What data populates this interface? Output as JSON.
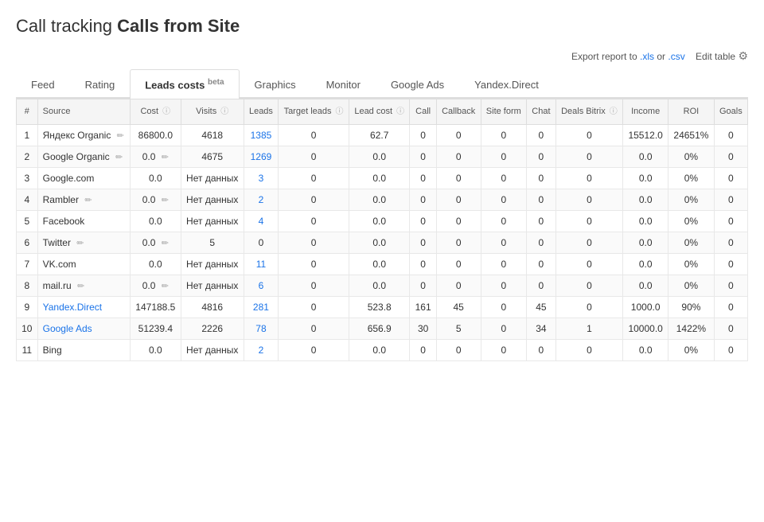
{
  "title": {
    "prefix": "Call tracking",
    "bold": "Calls from Site"
  },
  "export": {
    "text": "Export report to",
    "xls": ".xls",
    "or": "or",
    "csv": ".csv",
    "edit_table": "Edit table"
  },
  "tabs": [
    {
      "id": "feed",
      "label": "Feed",
      "active": false
    },
    {
      "id": "rating",
      "label": "Rating",
      "active": false
    },
    {
      "id": "leads_costs",
      "label": "Leads costs",
      "beta": "beta",
      "active": true
    },
    {
      "id": "graphics",
      "label": "Graphics",
      "active": false
    },
    {
      "id": "monitor",
      "label": "Monitor",
      "active": false
    },
    {
      "id": "google_ads",
      "label": "Google Ads",
      "active": false
    },
    {
      "id": "yandex_direct",
      "label": "Yandex.Direct",
      "active": false
    }
  ],
  "columns": [
    {
      "id": "num",
      "label": "#"
    },
    {
      "id": "source",
      "label": "Source"
    },
    {
      "id": "cost",
      "label": "Cost",
      "info": true
    },
    {
      "id": "visits",
      "label": "Visits",
      "info": true
    },
    {
      "id": "leads",
      "label": "Leads"
    },
    {
      "id": "target_leads",
      "label": "Target leads",
      "info": true
    },
    {
      "id": "lead_cost",
      "label": "Lead cost",
      "info": true
    },
    {
      "id": "call",
      "label": "Call"
    },
    {
      "id": "callback",
      "label": "Callback"
    },
    {
      "id": "site_form",
      "label": "Site form"
    },
    {
      "id": "chat",
      "label": "Chat"
    },
    {
      "id": "deals_bitrix",
      "label": "Deals Bitrix",
      "info": true
    },
    {
      "id": "income",
      "label": "Income"
    },
    {
      "id": "roi",
      "label": "ROI"
    },
    {
      "id": "goals",
      "label": "Goals"
    }
  ],
  "rows": [
    {
      "num": 1,
      "source": "Яндекс Organic",
      "editable": true,
      "cost": "86800.0",
      "visits": "4618",
      "leads_link": "1385",
      "leads_link_href": true,
      "target_leads": "0",
      "lead_cost": "62.7",
      "call": "0",
      "callback": "0",
      "site_form": "0",
      "chat": "0",
      "deals_bitrix": "0",
      "income": "15512.0",
      "roi": "24651%",
      "goals": "0"
    },
    {
      "num": 2,
      "source": "Google Organic",
      "editable": true,
      "cost": "0.0",
      "cost_editable": true,
      "visits": "4675",
      "leads_link": "1269",
      "leads_link_href": true,
      "target_leads": "0",
      "lead_cost": "0.0",
      "call": "0",
      "callback": "0",
      "site_form": "0",
      "chat": "0",
      "deals_bitrix": "0",
      "income": "0.0",
      "roi": "0%",
      "goals": "0"
    },
    {
      "num": 3,
      "source": "Google.com",
      "editable": false,
      "cost": "0.0",
      "visits": "Нет данных",
      "leads_link": "3",
      "leads_link_href": true,
      "target_leads": "0",
      "lead_cost": "0.0",
      "call": "0",
      "callback": "0",
      "site_form": "0",
      "chat": "0",
      "deals_bitrix": "0",
      "income": "0.0",
      "roi": "0%",
      "goals": "0"
    },
    {
      "num": 4,
      "source": "Rambler",
      "editable": true,
      "cost": "0.0",
      "cost_editable": true,
      "visits": "Нет данных",
      "leads_link": "2",
      "leads_link_href": true,
      "target_leads": "0",
      "lead_cost": "0.0",
      "call": "0",
      "callback": "0",
      "site_form": "0",
      "chat": "0",
      "deals_bitrix": "0",
      "income": "0.0",
      "roi": "0%",
      "goals": "0"
    },
    {
      "num": 5,
      "source": "Facebook",
      "editable": false,
      "cost": "0.0",
      "visits": "Нет данных",
      "leads_link": "4",
      "leads_link_href": true,
      "target_leads": "0",
      "lead_cost": "0.0",
      "call": "0",
      "callback": "0",
      "site_form": "0",
      "chat": "0",
      "deals_bitrix": "0",
      "income": "0.0",
      "roi": "0%",
      "goals": "0"
    },
    {
      "num": 6,
      "source": "Twitter",
      "editable": true,
      "cost": "0.0",
      "cost_editable": true,
      "visits": "5",
      "leads_link": "0",
      "leads_link_href": false,
      "target_leads": "0",
      "lead_cost": "0.0",
      "call": "0",
      "callback": "0",
      "site_form": "0",
      "chat": "0",
      "deals_bitrix": "0",
      "income": "0.0",
      "roi": "0%",
      "goals": "0"
    },
    {
      "num": 7,
      "source": "VK.com",
      "editable": false,
      "cost": "0.0",
      "visits": "Нет данных",
      "leads_link": "11",
      "leads_link_href": true,
      "target_leads": "0",
      "lead_cost": "0.0",
      "call": "0",
      "callback": "0",
      "site_form": "0",
      "chat": "0",
      "deals_bitrix": "0",
      "income": "0.0",
      "roi": "0%",
      "goals": "0"
    },
    {
      "num": 8,
      "source": "mail.ru",
      "editable": true,
      "cost": "0.0",
      "cost_editable": true,
      "visits": "Нет данных",
      "leads_link": "6",
      "leads_link_href": true,
      "target_leads": "0",
      "lead_cost": "0.0",
      "call": "0",
      "callback": "0",
      "site_form": "0",
      "chat": "0",
      "deals_bitrix": "0",
      "income": "0.0",
      "roi": "0%",
      "goals": "0"
    },
    {
      "num": 9,
      "source": "Yandex.Direct",
      "source_link": true,
      "editable": false,
      "cost": "147188.5",
      "visits": "4816",
      "leads_link": "281",
      "leads_link_href": true,
      "target_leads": "0",
      "lead_cost": "523.8",
      "call": "161",
      "callback": "45",
      "site_form": "0",
      "chat": "45",
      "deals_bitrix": "0",
      "income": "1000.0",
      "roi": "90%",
      "goals": "0"
    },
    {
      "num": 10,
      "source": "Google Ads",
      "source_link": true,
      "editable": false,
      "cost": "51239.4",
      "visits": "2226",
      "leads_link": "78",
      "leads_link_href": true,
      "target_leads": "0",
      "lead_cost": "656.9",
      "call": "30",
      "callback": "5",
      "site_form": "0",
      "chat": "34",
      "deals_bitrix": "1",
      "income": "10000.0",
      "roi": "1422%",
      "goals": "0"
    },
    {
      "num": 11,
      "source": "Bing",
      "editable": false,
      "cost": "0.0",
      "visits": "Нет данных",
      "leads_link": "2",
      "leads_link_href": true,
      "target_leads": "0",
      "lead_cost": "0.0",
      "call": "0",
      "callback": "0",
      "site_form": "0",
      "chat": "0",
      "deals_bitrix": "0",
      "income": "0.0",
      "roi": "0%",
      "goals": "0"
    }
  ]
}
